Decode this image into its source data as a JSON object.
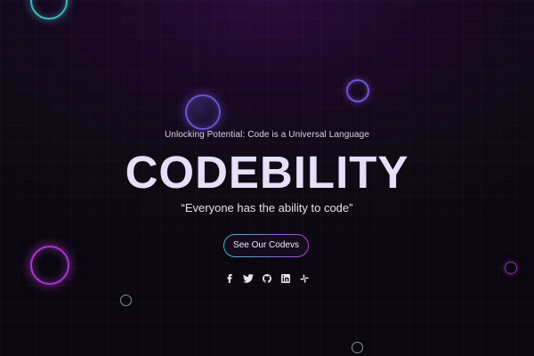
{
  "hero": {
    "subtitle": "Unlocking Potential: Code is a Universal Language",
    "title": "CODEBILITY",
    "quote": "“Everyone has the ability to code”",
    "cta_label": "See Our Codevs"
  },
  "socials": [
    {
      "icon": "facebook-icon"
    },
    {
      "icon": "twitter-icon"
    },
    {
      "icon": "github-icon"
    },
    {
      "icon": "linkedin-icon"
    },
    {
      "icon": "slack-icon"
    }
  ],
  "colors": {
    "background": "#0b0710",
    "accent_cyan": "#3cc1c8",
    "accent_purple": "#b23de0",
    "title_text": "#e8defa"
  }
}
